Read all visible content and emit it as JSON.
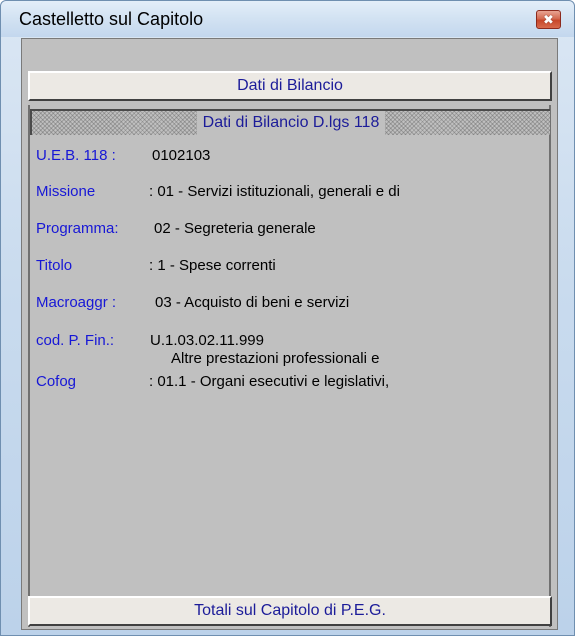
{
  "window": {
    "title": "Castelletto sul Capitolo",
    "close_symbol": "✖"
  },
  "buttons": {
    "dati_bilancio": "Dati di Bilancio",
    "totali": "Totali sul Capitolo di P.E.G."
  },
  "section_header": "Dati di Bilancio D.lgs 118",
  "fields": {
    "ueb": {
      "label": "U.E.B. 118 :",
      "value": "0102103"
    },
    "missione": {
      "label": "Missione",
      "value": ": 01 - Servizi istituzionali, generali e di"
    },
    "programma": {
      "label": "Programma:",
      "value": "02 - Segreteria generale"
    },
    "titolo": {
      "label": "Titolo",
      "value": ": 1 - Spese correnti"
    },
    "macroaggr": {
      "label": "Macroaggr :",
      "value": "03 - Acquisto di beni e servizi"
    },
    "cod_pfin": {
      "label": "cod. P. Fin.:",
      "value": "U.1.03.02.11.999",
      "extra": "Altre prestazioni professionali e"
    },
    "cofog": {
      "label": "Cofog",
      "value": ": 01.1 - Organi esecutivi e legislativi,"
    }
  },
  "colors": {
    "label_blue": "#1717d6",
    "button_text": "#1c1c99",
    "panel_gray": "#c0c0c0",
    "close_red": "#c7472a"
  },
  "icons": {
    "close": "close-icon"
  }
}
